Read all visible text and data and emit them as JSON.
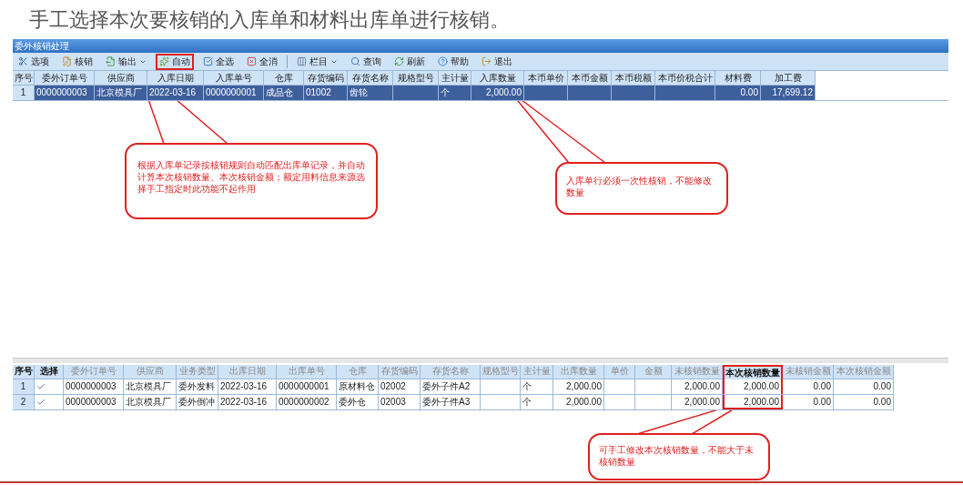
{
  "page_title": "手工选择本次要核销的入库单和材料出库单进行核销。",
  "window": {
    "title": "委外核销处理"
  },
  "toolbar": [
    {
      "label": "选项",
      "has_menu": false,
      "highlighted": false
    },
    {
      "label": "核销",
      "has_menu": false,
      "highlighted": false
    },
    {
      "label": "输出",
      "has_menu": true,
      "highlighted": false
    },
    {
      "label": "自动",
      "has_menu": false,
      "highlighted": true
    },
    {
      "label": "全选",
      "has_menu": false,
      "highlighted": false
    },
    {
      "label": "全消",
      "has_menu": false,
      "highlighted": false
    },
    {
      "label": "栏目",
      "has_menu": true,
      "highlighted": false
    },
    {
      "label": "查询",
      "has_menu": false,
      "highlighted": false
    },
    {
      "label": "刷新",
      "has_menu": false,
      "highlighted": false
    },
    {
      "label": "帮助",
      "has_menu": false,
      "highlighted": false
    },
    {
      "label": "退出",
      "has_menu": false,
      "highlighted": false
    }
  ],
  "receipt_table": {
    "columns": [
      "序号",
      "委外订单号",
      "供应商",
      "入库日期",
      "入库单号",
      "仓库",
      "存货编码",
      "存货名称",
      "规格型号",
      "主计量",
      "入库数量",
      "本币单价",
      "本币金额",
      "本币税额",
      "本币价税合计",
      "材料费",
      "加工费"
    ],
    "rows": [
      {
        "selected": true,
        "cells": [
          "1",
          "0000000003",
          "北京模具厂",
          "2022-03-16",
          "0000000001",
          "成品仓",
          "01002",
          "齿轮",
          "",
          "个",
          "2,000.00",
          "",
          "",
          "",
          "",
          "0.00",
          "17,699.12"
        ]
      }
    ]
  },
  "issue_table": {
    "columns": [
      {
        "label": "序号",
        "emphasized": true,
        "highlighted": false
      },
      {
        "label": "选择",
        "emphasized": true,
        "highlighted": false
      },
      {
        "label": "委外订单号",
        "emphasized": false,
        "highlighted": false
      },
      {
        "label": "供应商",
        "emphasized": false,
        "highlighted": false
      },
      {
        "label": "业务类型",
        "emphasized": false,
        "highlighted": false
      },
      {
        "label": "出库日期",
        "emphasized": false,
        "highlighted": false
      },
      {
        "label": "出库单号",
        "emphasized": false,
        "highlighted": false
      },
      {
        "label": "仓库",
        "emphasized": false,
        "highlighted": false
      },
      {
        "label": "存货编码",
        "emphasized": false,
        "highlighted": false
      },
      {
        "label": "存货名称",
        "emphasized": false,
        "highlighted": false
      },
      {
        "label": "规格型号",
        "emphasized": false,
        "highlighted": false
      },
      {
        "label": "主计量",
        "emphasized": false,
        "highlighted": false
      },
      {
        "label": "出库数量",
        "emphasized": false,
        "highlighted": false
      },
      {
        "label": "单价",
        "emphasized": false,
        "highlighted": false
      },
      {
        "label": "金额",
        "emphasized": false,
        "highlighted": false
      },
      {
        "label": "未核销数量",
        "emphasized": false,
        "highlighted": false
      },
      {
        "label": "本次核销数量",
        "emphasized": true,
        "highlighted": true
      },
      {
        "label": "未核销金额",
        "emphasized": false,
        "highlighted": false
      },
      {
        "label": "本次核销金额",
        "emphasized": false,
        "highlighted": false
      }
    ],
    "rows": [
      {
        "checked": true,
        "cells": [
          "1",
          "",
          "0000000003",
          "北京模具厂",
          "委外发料",
          "2022-03-16",
          "0000000001",
          "原材料仓",
          "02002",
          "委外子件A2",
          "",
          "个",
          "2,000.00",
          "",
          "",
          "2,000.00",
          "2,000.00",
          "0.00",
          "0.00"
        ]
      },
      {
        "checked": true,
        "cells": [
          "2",
          "",
          "0000000003",
          "北京模具厂",
          "委外倒冲",
          "2022-03-16",
          "0000000002",
          "委外仓",
          "02003",
          "委外子件A3",
          "",
          "个",
          "2,000.00",
          "",
          "",
          "2,000.00",
          "2,000.00",
          "0.00",
          "0.00"
        ]
      }
    ]
  },
  "callouts": [
    "根据入库单记录按核销规则自动匹配出库单记录，并自动计算本次核销数量、本次核销金额；额定用料信息来源选择手工指定时此功能不起作用",
    "入库单行必须一次性核销，不能修改数量",
    "可手工修改本次核销数量，不能大于未核销数量"
  ]
}
